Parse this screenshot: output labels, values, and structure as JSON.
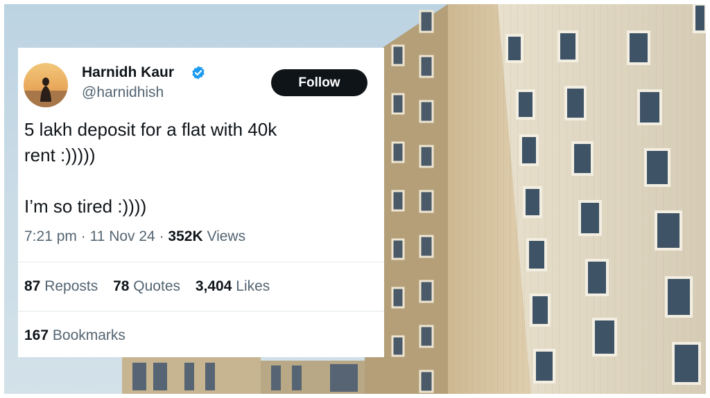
{
  "tweet": {
    "author_name": "Harnidh Kaur",
    "handle": "@harnidhish",
    "follow_label": "Follow",
    "text_line1": "5 lakh deposit for a flat with 40k",
    "text_line2": "rent :)))))",
    "text_line3": "I’m so tired :))))",
    "time": "7:21 pm",
    "separator": " · ",
    "date": "11 Nov 24",
    "views_count": "352K",
    "views_label": "Views",
    "reposts_count": "87",
    "reposts_label": "Reposts",
    "quotes_count": "78",
    "quotes_label": "Quotes",
    "likes_count": "3,404",
    "likes_label": "Likes",
    "bookmarks_count": "167",
    "bookmarks_label": "Bookmarks"
  },
  "colors": {
    "verified_badge": "#1d9bf0",
    "follow_button": "#0f1419",
    "secondary_text": "#536471",
    "sky": "#c9dbe6",
    "building": "#d9c9a6"
  },
  "icons": {
    "verified": "verified-badge-icon",
    "avatar": "profile-photo"
  }
}
